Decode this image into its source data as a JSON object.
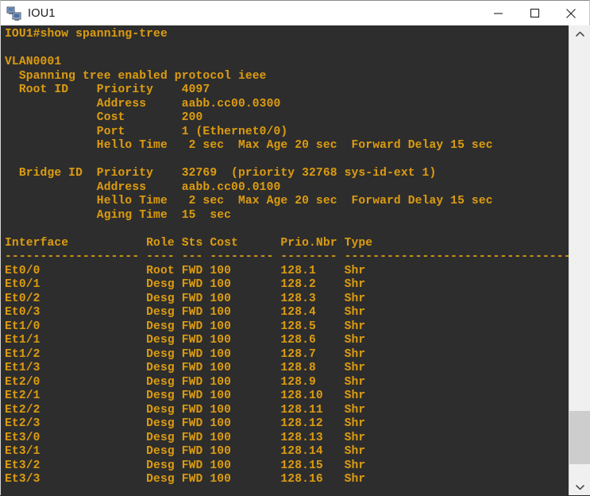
{
  "window": {
    "title": "IOU1",
    "icon": "network-computer-icon",
    "controls": [
      {
        "name": "minimize-button",
        "glyph": "minimize-icon",
        "label": "Minimize"
      },
      {
        "name": "maximize-button",
        "glyph": "maximize-icon",
        "label": "Maximize"
      },
      {
        "name": "close-button",
        "glyph": "close-icon",
        "label": "Close"
      }
    ]
  },
  "theme": {
    "terminal_background": "#2d2d2d",
    "terminal_foreground": "#d99a12",
    "titlebar_background": "#ffffff",
    "titlebar_foreground": "#1b1b1b",
    "scrollbar_track": "#f0f0f0",
    "scrollbar_thumb": "#cdcdcd"
  },
  "terminal": {
    "prompt": "IOU1#",
    "command": "show spanning-tree",
    "prompt_line": "IOU1#show spanning-tree",
    "vlan": {
      "name": "VLAN0001",
      "protocol_line": "  Spanning tree enabled protocol ieee",
      "root_id": {
        "label": "Root ID",
        "priority": "4097",
        "address": "aabb.cc00.0300",
        "cost": "200",
        "port": "1 (Ethernet0/0)",
        "hello_time": "2 sec",
        "max_age": "20 sec",
        "forward_delay": "15 sec"
      },
      "bridge_id": {
        "label": "Bridge ID",
        "priority": "32769",
        "priority_detail": "(priority 32768 sys-id-ext 1)",
        "address": "aabb.cc00.0100",
        "hello_time": "2 sec",
        "max_age": "20 sec",
        "forward_delay": "15 sec",
        "aging_time": "15  sec"
      }
    },
    "table": {
      "headers": [
        "Interface",
        "Role",
        "Sts",
        "Cost",
        "Prio.Nbr",
        "Type"
      ],
      "separator": "------------------- ---- --- --------- -------- --------------------------------",
      "rows": [
        {
          "interface": "Et0/0",
          "role": "Root",
          "sts": "FWD",
          "cost": "100",
          "prio_nbr": "128.1",
          "type": "Shr"
        },
        {
          "interface": "Et0/1",
          "role": "Desg",
          "sts": "FWD",
          "cost": "100",
          "prio_nbr": "128.2",
          "type": "Shr"
        },
        {
          "interface": "Et0/2",
          "role": "Desg",
          "sts": "FWD",
          "cost": "100",
          "prio_nbr": "128.3",
          "type": "Shr"
        },
        {
          "interface": "Et0/3",
          "role": "Desg",
          "sts": "FWD",
          "cost": "100",
          "prio_nbr": "128.4",
          "type": "Shr"
        },
        {
          "interface": "Et1/0",
          "role": "Desg",
          "sts": "FWD",
          "cost": "100",
          "prio_nbr": "128.5",
          "type": "Shr"
        },
        {
          "interface": "Et1/1",
          "role": "Desg",
          "sts": "FWD",
          "cost": "100",
          "prio_nbr": "128.6",
          "type": "Shr"
        },
        {
          "interface": "Et1/2",
          "role": "Desg",
          "sts": "FWD",
          "cost": "100",
          "prio_nbr": "128.7",
          "type": "Shr"
        },
        {
          "interface": "Et1/3",
          "role": "Desg",
          "sts": "FWD",
          "cost": "100",
          "prio_nbr": "128.8",
          "type": "Shr"
        },
        {
          "interface": "Et2/0",
          "role": "Desg",
          "sts": "FWD",
          "cost": "100",
          "prio_nbr": "128.9",
          "type": "Shr"
        },
        {
          "interface": "Et2/1",
          "role": "Desg",
          "sts": "FWD",
          "cost": "100",
          "prio_nbr": "128.10",
          "type": "Shr"
        },
        {
          "interface": "Et2/2",
          "role": "Desg",
          "sts": "FWD",
          "cost": "100",
          "prio_nbr": "128.11",
          "type": "Shr"
        },
        {
          "interface": "Et2/3",
          "role": "Desg",
          "sts": "FWD",
          "cost": "100",
          "prio_nbr": "128.12",
          "type": "Shr"
        },
        {
          "interface": "Et3/0",
          "role": "Desg",
          "sts": "FWD",
          "cost": "100",
          "prio_nbr": "128.13",
          "type": "Shr"
        },
        {
          "interface": "Et3/1",
          "role": "Desg",
          "sts": "FWD",
          "cost": "100",
          "prio_nbr": "128.14",
          "type": "Shr"
        },
        {
          "interface": "Et3/2",
          "role": "Desg",
          "sts": "FWD",
          "cost": "100",
          "prio_nbr": "128.15",
          "type": "Shr"
        },
        {
          "interface": "Et3/3",
          "role": "Desg",
          "sts": "FWD",
          "cost": "100",
          "prio_nbr": "128.16",
          "type": "Shr"
        }
      ]
    },
    "screen_text": "IOU1#show spanning-tree\n\nVLAN0001\n  Spanning tree enabled protocol ieee\n  Root ID    Priority    4097\n             Address     aabb.cc00.0300\n             Cost        200\n             Port        1 (Ethernet0/0)\n             Hello Time   2 sec  Max Age 20 sec  Forward Delay 15 sec\n\n  Bridge ID  Priority    32769  (priority 32768 sys-id-ext 1)\n             Address     aabb.cc00.0100\n             Hello Time   2 sec  Max Age 20 sec  Forward Delay 15 sec\n             Aging Time  15  sec\n\nInterface           Role Sts Cost      Prio.Nbr Type\n------------------- ---- --- --------- -------- --------------------------------\nEt0/0               Root FWD 100       128.1    Shr\nEt0/1               Desg FWD 100       128.2    Shr\nEt0/2               Desg FWD 100       128.3    Shr\nEt0/3               Desg FWD 100       128.4    Shr\nEt1/0               Desg FWD 100       128.5    Shr\nEt1/1               Desg FWD 100       128.6    Shr\nEt1/2               Desg FWD 100       128.7    Shr\nEt1/3               Desg FWD 100       128.8    Shr\nEt2/0               Desg FWD 100       128.9    Shr\nEt2/1               Desg FWD 100       128.10   Shr\nEt2/2               Desg FWD 100       128.11   Shr\nEt2/3               Desg FWD 100       128.12   Shr\nEt3/0               Desg FWD 100       128.13   Shr\nEt3/1               Desg FWD 100       128.14   Shr\nEt3/2               Desg FWD 100       128.15   Shr\nEt3/3               Desg FWD 100       128.16   Shr"
  },
  "scrollbar": {
    "up_arrow": "chevron-up-icon",
    "down_arrow": "chevron-down-icon",
    "thumb_top_pct": 84.5,
    "thumb_height_pct": 12.2
  }
}
